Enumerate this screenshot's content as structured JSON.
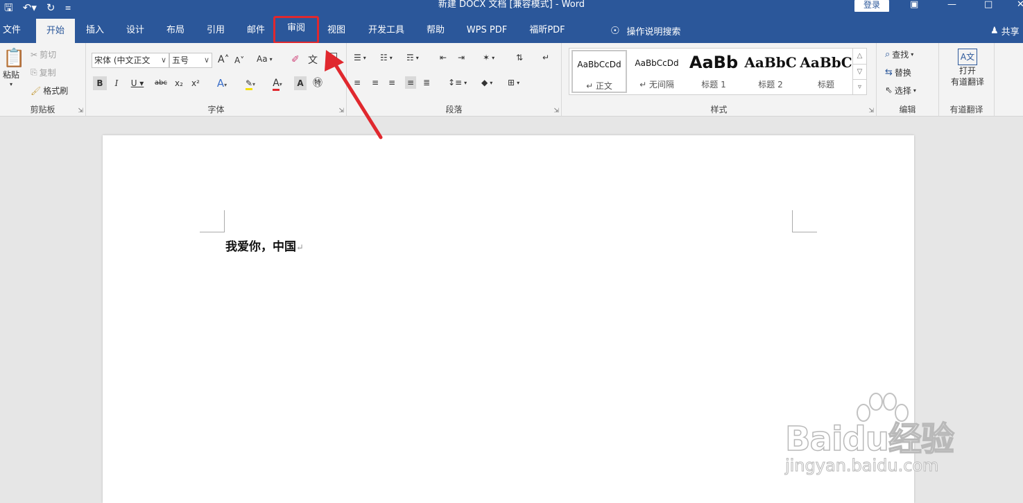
{
  "window": {
    "title": "新建 DOCX 文档 [兼容模式] - Word",
    "login_label": "登录"
  },
  "tabs": [
    {
      "label": "文件"
    },
    {
      "label": "开始"
    },
    {
      "label": "插入"
    },
    {
      "label": "设计"
    },
    {
      "label": "布局"
    },
    {
      "label": "引用"
    },
    {
      "label": "邮件"
    },
    {
      "label": "审阅"
    },
    {
      "label": "视图"
    },
    {
      "label": "开发工具"
    },
    {
      "label": "帮助"
    },
    {
      "label": "WPS PDF"
    },
    {
      "label": "福昕PDF"
    }
  ],
  "active_tab": "开始",
  "highlighted_tab": "审阅",
  "tell_me": "操作说明搜索",
  "share_label": "共享",
  "clipboard": {
    "paste": "粘贴",
    "cut": "剪切",
    "copy": "复制",
    "format_painter": "格式刷",
    "group_label": "剪贴板"
  },
  "font": {
    "font_name": "宋体 (中文正文",
    "font_size": "五号",
    "change_case": "Aa",
    "group_label": "字体"
  },
  "paragraph": {
    "group_label": "段落"
  },
  "styles": {
    "items": [
      {
        "sample": "AaBbCcDd",
        "name": "↵ 正文"
      },
      {
        "sample": "AaBbCcDd",
        "name": "↵ 无间隔"
      },
      {
        "sample": "AaBb",
        "name": "标题 1"
      },
      {
        "sample": "AaBbC",
        "name": "标题 2"
      },
      {
        "sample": "AaBbC",
        "name": "标题"
      }
    ],
    "group_label": "样式"
  },
  "editing": {
    "find": "查找",
    "replace": "替换",
    "select": "选择",
    "group_label": "编辑"
  },
  "youdao": {
    "open_line1": "打开",
    "open_line2": "有道翻译",
    "group_label": "有道翻译"
  },
  "document": {
    "text": "我爱你，中国",
    "paragraph_mark": "↵"
  },
  "watermark": {
    "main": "Baidu经验",
    "sub": "jingyan.baidu.com"
  },
  "colors": {
    "accent": "#2b579a",
    "highlight_box": "#e0282e"
  }
}
